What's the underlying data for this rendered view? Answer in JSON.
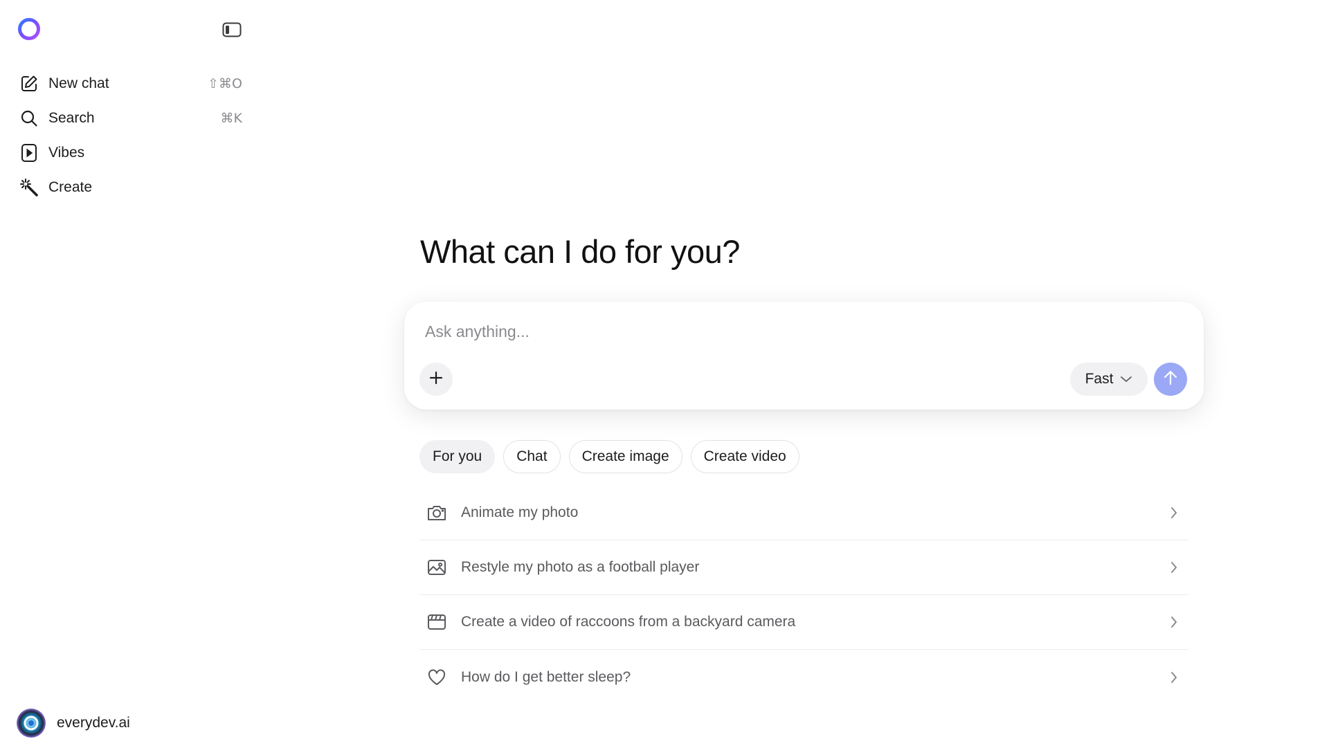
{
  "sidebar": {
    "logo_icon": "ring-logo-icon",
    "toggle_icon": "sidebar-toggle-icon",
    "items": [
      {
        "label": "New chat",
        "shortcut": "⇧⌘O",
        "icon": "edit-icon"
      },
      {
        "label": "Search",
        "shortcut": "⌘K",
        "icon": "search-icon"
      },
      {
        "label": "Vibes",
        "shortcut": "",
        "icon": "play-icon"
      },
      {
        "label": "Create",
        "shortcut": "",
        "icon": "magic-wand-icon"
      }
    ],
    "profile": {
      "name": "everydev.ai",
      "icon": "avatar-icon"
    }
  },
  "main": {
    "headline": "What can I do for you?",
    "composer": {
      "placeholder": "Ask anything...",
      "model_label": "Fast",
      "plus_icon": "plus-icon",
      "send_icon": "arrow-up-icon"
    },
    "chips": [
      {
        "label": "For you",
        "active": true
      },
      {
        "label": "Chat",
        "active": false
      },
      {
        "label": "Create image",
        "active": false
      },
      {
        "label": "Create video",
        "active": false
      }
    ],
    "suggestions": [
      {
        "label": "Animate my photo",
        "icon": "camera-icon"
      },
      {
        "label": "Restyle my photo as a football player",
        "icon": "image-icon"
      },
      {
        "label": "Create a video of raccoons from a backyard camera",
        "icon": "clapperboard-icon"
      },
      {
        "label": "How do I get better sleep?",
        "icon": "heart-icon"
      }
    ]
  },
  "colors": {
    "accent": "#9aa8f5",
    "chip_active_bg": "#f1f1f3",
    "muted_text": "#5a5a5e"
  }
}
